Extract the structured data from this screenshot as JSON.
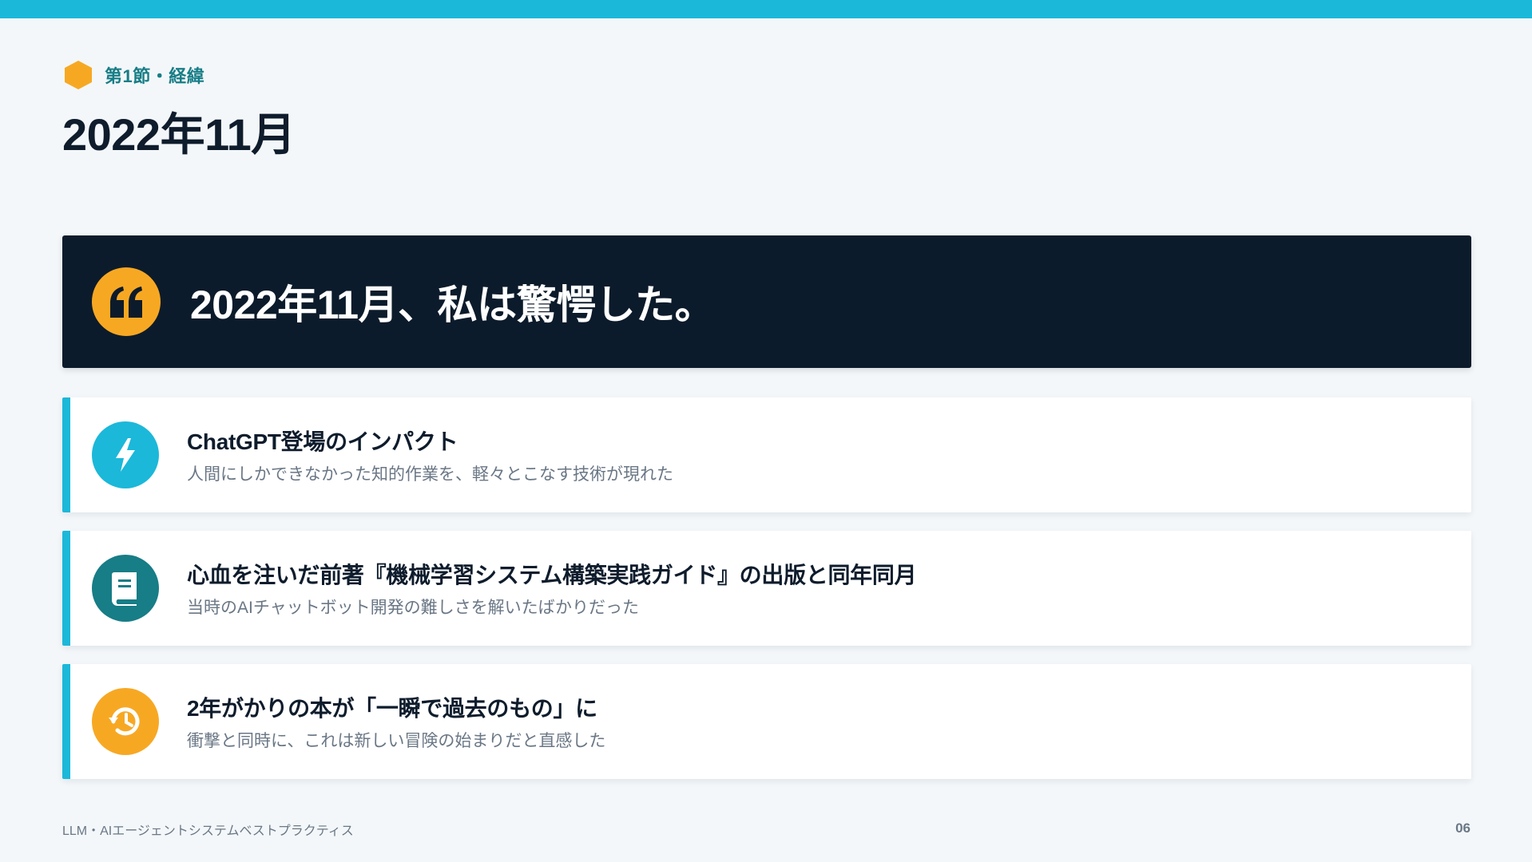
{
  "section": {
    "label": "第1節・経緯",
    "icon": "hexagon-icon",
    "icon_color": "#f7a823"
  },
  "title": "2022年11月",
  "hero": {
    "text": "2022年11月、私は驚愕した。",
    "icon": "quote-icon",
    "icon_color": "#f7a823"
  },
  "cards": [
    {
      "title": "ChatGPT登場のインパクト",
      "subtitle": "人間にしかできなかった知的作業を、軽々とこなす技術が現れた",
      "icon": "lightning-icon",
      "icon_color": "#1bb8d9"
    },
    {
      "title": "心血を注いだ前著『機械学習システム構築実践ガイド』の出版と同年同月",
      "subtitle": "当時のAIチャットボット開発の難しさを解いたばかりだった",
      "icon": "book-icon",
      "icon_color": "#177d86"
    },
    {
      "title": "2年がかりの本が「一瞬で過去のもの」に",
      "subtitle": "衝撃と同時に、これは新しい冒険の始まりだと直感した",
      "icon": "history-icon",
      "icon_color": "#f7a823"
    }
  ],
  "footer": {
    "text": "LLM・AIエージェントシステムベストプラクティス",
    "page": "06"
  },
  "colors": {
    "accent": "#1bb8d9",
    "dark": "#0c1b2b",
    "background": "#f3f7fa"
  }
}
